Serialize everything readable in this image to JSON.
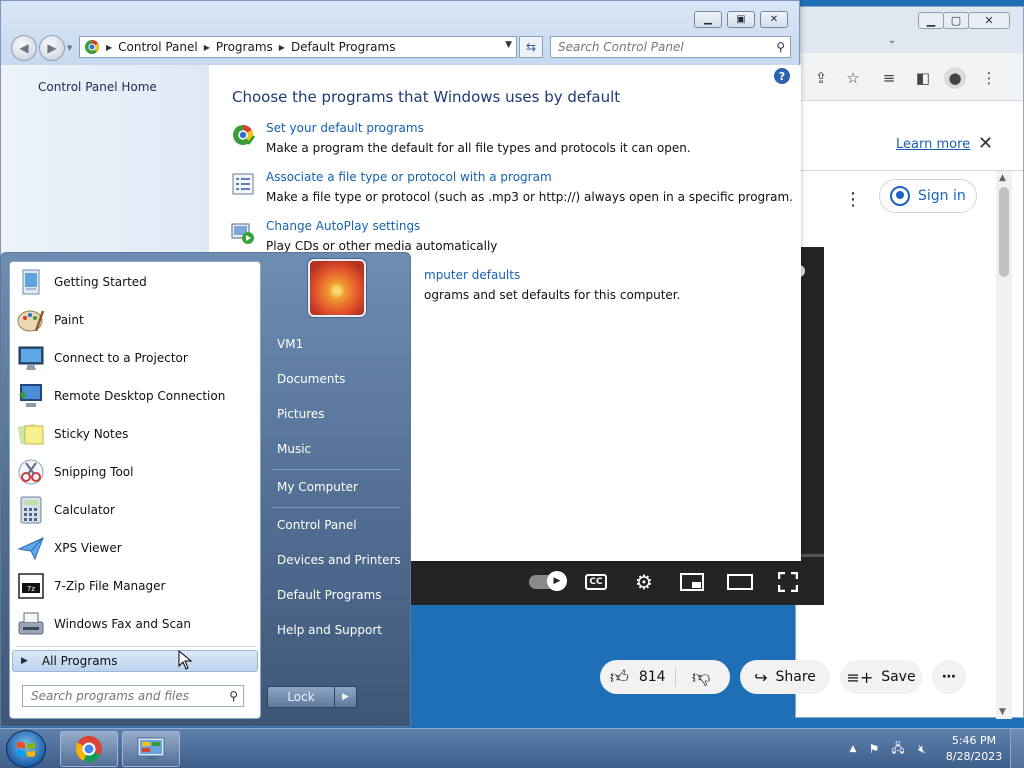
{
  "browser": {
    "info_bar": {
      "learn_more": "Learn more"
    },
    "youtube": {
      "signin_label": "Sign in",
      "progress_fraction": 0.02,
      "like_count": "814",
      "share_label": "Share",
      "save_label": "Save"
    }
  },
  "control_panel": {
    "breadcrumbs": [
      "Control Panel",
      "Programs",
      "Default Programs"
    ],
    "search_placeholder": "Search Control Panel",
    "left_link": "Control Panel Home",
    "heading": "Choose the programs that Windows uses by default",
    "tasks": [
      {
        "link": "Set your default programs",
        "desc": "Make a program the default for all file types and protocols it can open.",
        "icon": "default-programs-icon"
      },
      {
        "link": "Associate a file type or protocol with a program",
        "desc": "Make a file type or protocol (such as .mp3 or http://) always open in a specific program.",
        "icon": "file-association-icon"
      },
      {
        "link": "Change AutoPlay settings",
        "desc": "Play CDs or other media automatically",
        "icon": "autoplay-icon"
      },
      {
        "link": "mputer defaults",
        "desc": "ograms and set defaults for this computer.",
        "icon": ""
      }
    ]
  },
  "start_menu": {
    "programs": [
      {
        "label": "Getting Started",
        "icon": "getting-started-icon"
      },
      {
        "label": "Paint",
        "icon": "paint-icon"
      },
      {
        "label": "Connect to a Projector",
        "icon": "projector-icon"
      },
      {
        "label": "Remote Desktop Connection",
        "icon": "remote-desktop-icon"
      },
      {
        "label": "Sticky Notes",
        "icon": "sticky-notes-icon"
      },
      {
        "label": "Snipping Tool",
        "icon": "snipping-tool-icon"
      },
      {
        "label": "Calculator",
        "icon": "calculator-icon"
      },
      {
        "label": "XPS Viewer",
        "icon": "xps-viewer-icon"
      },
      {
        "label": "7-Zip File Manager",
        "icon": "7zip-icon"
      },
      {
        "label": "Windows Fax and Scan",
        "icon": "fax-scan-icon"
      }
    ],
    "all_programs": "All Programs",
    "search_placeholder": "Search programs and files",
    "right_items": [
      "VM1",
      "Documents",
      "Pictures",
      "Music",
      "My Computer",
      "Control Panel",
      "Devices and Printers",
      "Default Programs",
      "Help and Support"
    ],
    "lock_label": "Lock"
  },
  "taskbar": {
    "time": "5:46 PM",
    "date": "8/28/2023"
  }
}
